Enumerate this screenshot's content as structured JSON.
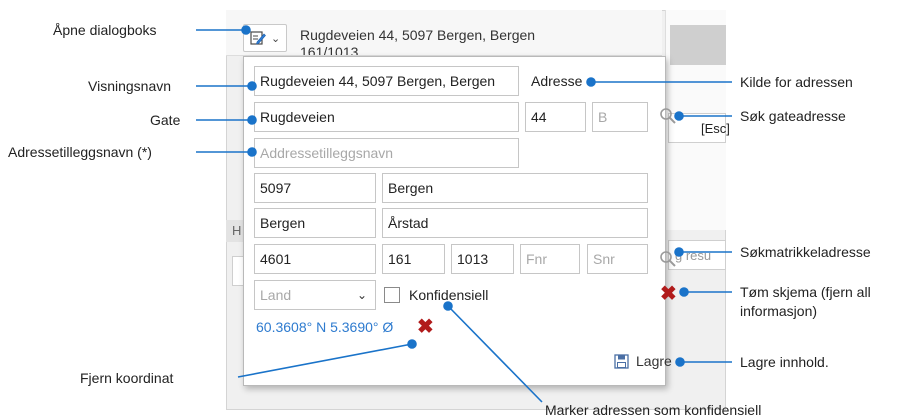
{
  "header": {
    "address_line1": "Rugdeveien 44, 5097 Bergen, Bergen",
    "address_line2": "161/1013"
  },
  "form": {
    "display_name": "Rugdeveien 44, 5097 Bergen, Bergen",
    "source_label": "Adresse",
    "street": "Rugdeveien",
    "house_number": "44",
    "letter_placeholder": "B",
    "supplement_placeholder": "Addressetilleggsnavn",
    "postal_code": "5097",
    "postal_place": "Bergen",
    "municipality": "Bergen",
    "district": "Årstad",
    "municipality_number": "4601",
    "gnr": "161",
    "bnr": "1013",
    "fnr_placeholder": "Fnr",
    "snr_placeholder": "Snr",
    "country_placeholder": "Land",
    "confidential_label": "Konfidensiell",
    "confidential_checked": false,
    "coordinate": "60.3608° N 5.3690° Ø",
    "save_label": "Lagre"
  },
  "background": {
    "esc_text": "[Esc]",
    "search_text": "g resu",
    "tab_text": "H"
  },
  "callouts": {
    "open_dialog": "Åpne dialogboks",
    "display_name": "Visningsnavn",
    "street": "Gate",
    "supplement": "Adressetilleggsnavn (*)",
    "address_source": "Kilde for adressen",
    "search_street": "Søk gateadresse",
    "search_cadastre": "Søkmatrikkeladresse",
    "clear_form_1": "Tøm skjema (fjern all",
    "clear_form_2": "informasjon)",
    "save_content": "Lagre innhold.",
    "remove_coordinate": "Fjern koordinat",
    "mark_confidential": "Marker adressen som konfidensiell"
  },
  "colors": {
    "accent": "#1a73c9",
    "delete": "#b11b1b",
    "coordinate": "#2e7bcf"
  }
}
